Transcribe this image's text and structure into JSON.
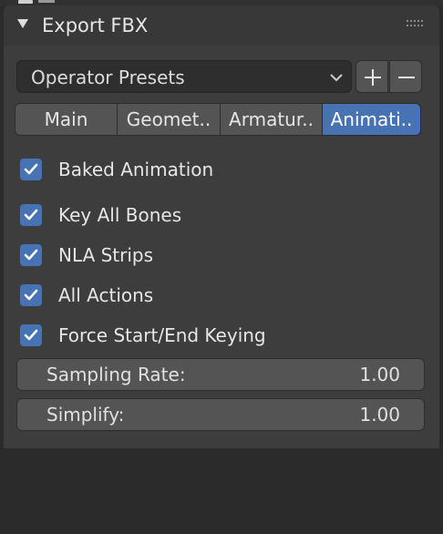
{
  "panel": {
    "title": "Export FBX"
  },
  "presets": {
    "label": "Operator Presets",
    "add_label": "+",
    "remove_label": "−"
  },
  "tabs": [
    {
      "label": "Main",
      "active": false
    },
    {
      "label": "Geomet..",
      "active": false
    },
    {
      "label": "Armatur..",
      "active": false
    },
    {
      "label": "Animati..",
      "active": true
    }
  ],
  "options": [
    {
      "label": "Baked Animation",
      "checked": true
    },
    {
      "label": "Key All Bones",
      "checked": true
    },
    {
      "label": "NLA Strips",
      "checked": true
    },
    {
      "label": "All Actions",
      "checked": true
    },
    {
      "label": "Force Start/End Keying",
      "checked": true
    }
  ],
  "fields": [
    {
      "label": "Sampling Rate:",
      "value": "1.00"
    },
    {
      "label": "Simplify:",
      "value": "1.00"
    }
  ],
  "colors": {
    "accent": "#4772b3",
    "panel_bg": "#3d3d3d",
    "button_bg": "#545454"
  }
}
